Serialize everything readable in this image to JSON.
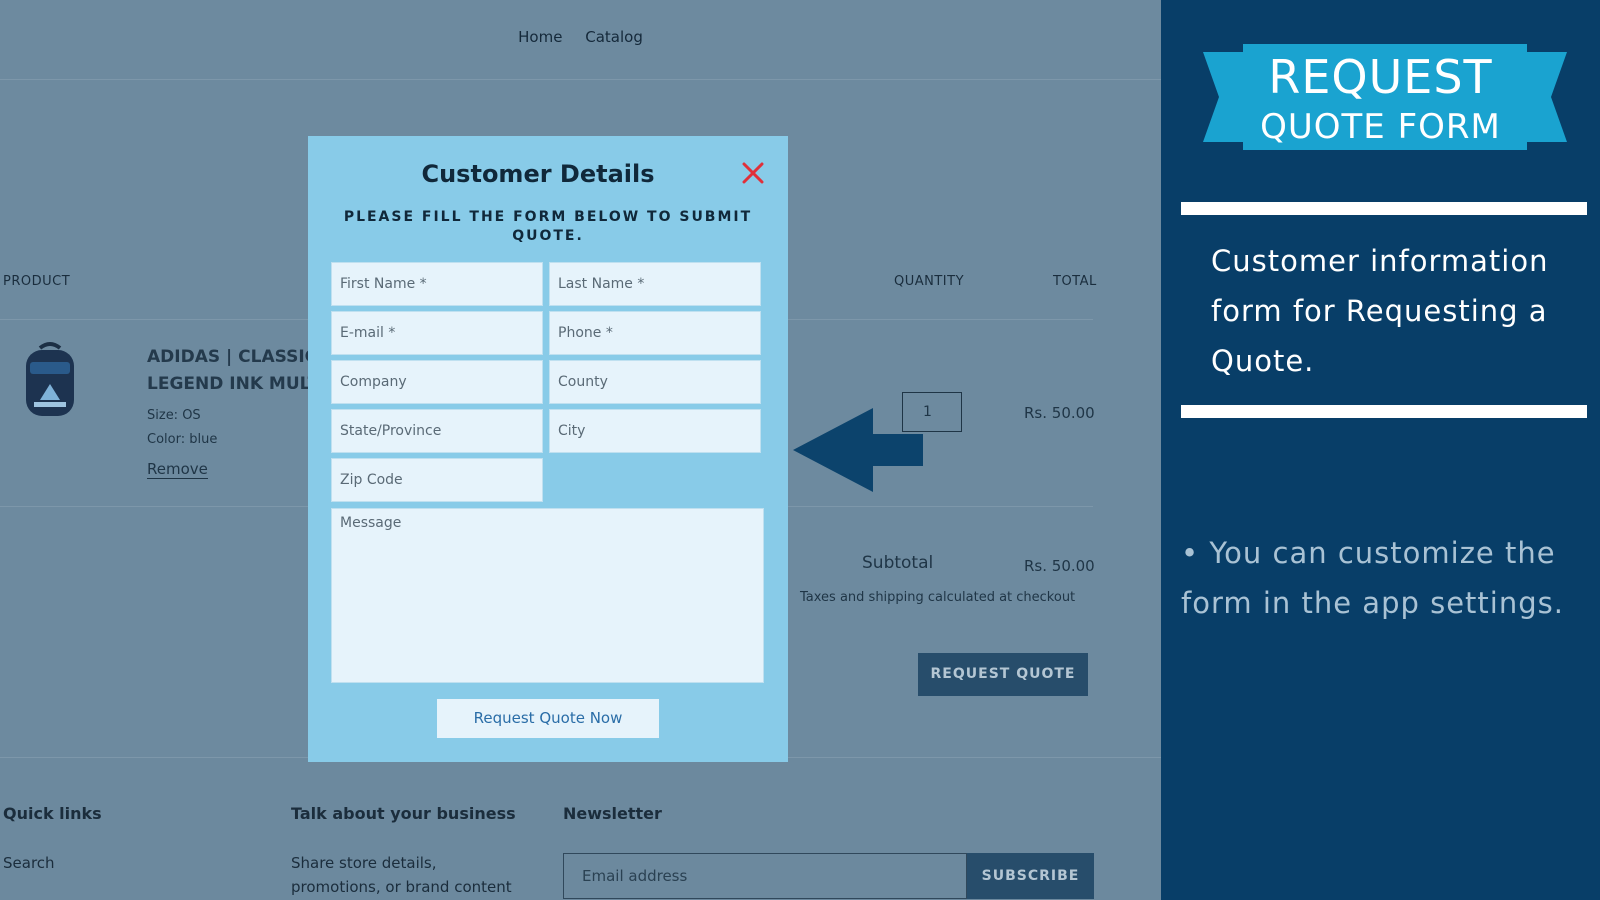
{
  "nav": {
    "items": [
      "Home",
      "Catalog"
    ]
  },
  "cart": {
    "headers": {
      "product": "PRODUCT",
      "quantity": "QUANTITY",
      "total": "TOTAL"
    },
    "item": {
      "title_line1": "ADIDAS | CLASSIC",
      "title_line2": "LEGEND INK MULT",
      "size": "Size: OS",
      "color": "Color: blue",
      "remove": "Remove",
      "quantity": "1",
      "total": "Rs. 50.00"
    },
    "subtotal_label": "Subtotal",
    "subtotal_value": "Rs. 50.00",
    "tax_note": "Taxes and shipping calculated at checkout",
    "request_quote_button": "REQUEST QUOTE"
  },
  "footer": {
    "quick_links_title": "Quick links",
    "search_link": "Search",
    "business_title": "Talk about your business",
    "business_text_line1": "Share store details,",
    "business_text_line2": "promotions, or brand content",
    "newsletter_title": "Newsletter",
    "email_placeholder": "Email address",
    "subscribe_button": "SUBSCRIBE"
  },
  "modal": {
    "title": "Customer Details",
    "subtitle": "PLEASE FILL THE FORM BELOW TO SUBMIT QUOTE.",
    "fields": {
      "first_name": "First Name *",
      "last_name": "Last Name *",
      "email": "E-mail *",
      "phone": "Phone *",
      "company": "Company",
      "county": "County",
      "state": "State/Province",
      "city": "City",
      "zip": "Zip Code",
      "message": "Message"
    },
    "submit_button": "Request Quote Now",
    "close_color": "#e0303a"
  },
  "panel": {
    "ribbon_line1": "REQUEST",
    "ribbon_line2": "QUOTE FORM",
    "description": "Customer information form for Requesting a Quote.",
    "note": "• You can customize the form in the app settings.",
    "background": "#083e68",
    "ribbon_color": "#1aa3d0"
  },
  "icons": {
    "arrow": "left-arrow-icon",
    "close": "close-icon",
    "product": "backpack-icon"
  }
}
